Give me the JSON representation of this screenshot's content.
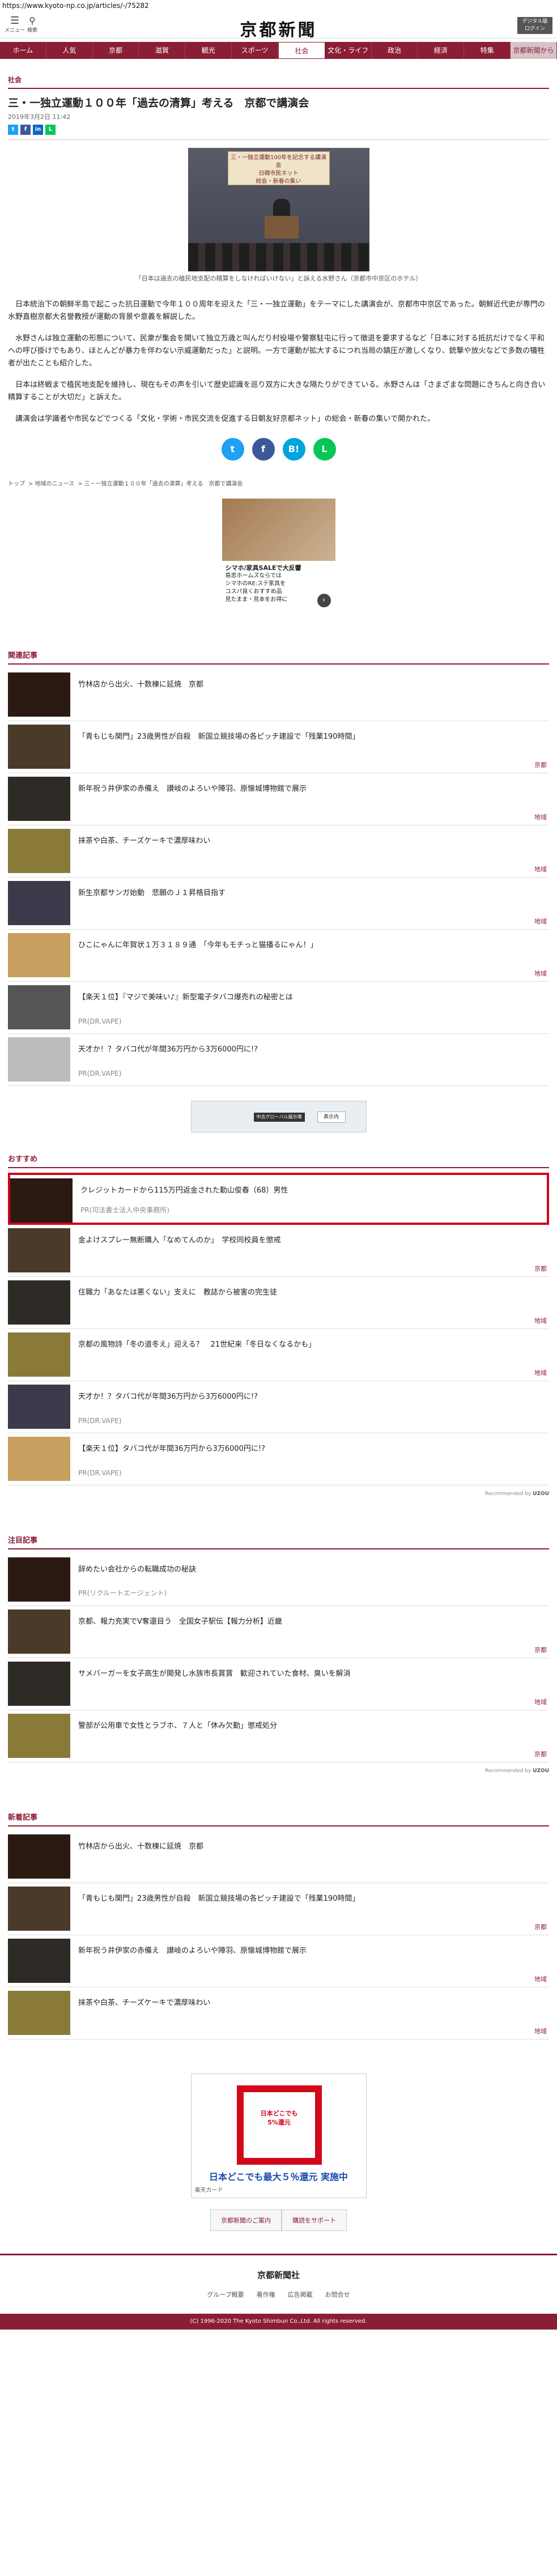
{
  "browser": {
    "url": "https://www.kyoto-np.co.jp/articles/-/75282"
  },
  "header": {
    "menu_label": "メニュー",
    "search_label": "検索",
    "logo_text": "京都新聞",
    "digital_label": "デジタル版\nログイン"
  },
  "nav": [
    "ホーム",
    "人気",
    "京都",
    "滋賀",
    "観光",
    "スポーツ",
    "社会",
    "文化・ライフ",
    "政治",
    "経済",
    "特集",
    "京都新聞から"
  ],
  "article": {
    "category": "社会",
    "title": "三・一独立運動１００年「過去の清算」考える　京都で講演会",
    "date": "2019年3月2日 11:42",
    "photo_banner": "三・一独立運動100年を記念する講演会\n日韓市民ネット\n総会・新春の集い",
    "caption": "「日本は過去の植民地支配の精算をしなければいけない」と訴える水野さん（京都市中京区のホテル）",
    "paragraphs": [
      "日本統治下の朝鮮半島で起こった抗日運動で今年１００周年を迎えた「三・一独立運動」をテーマにした講演会が、京都市中京区であった。朝鮮近代史が専門の水野直樹京都大名誉教授が運動の背景や意義を解説した。",
      "水野さんは独立運動の形態について、民衆が集会を開いて独立万歳と叫んだり村役場や警察駐屯に行って徴退を要求するなど「日本に対する抵抗だけでなく平和への呼び掛けでもあり、ほとんどが暴力を伴わない示威運動だった」と説明。一方で運動が拡大するにつれ当局の鎮圧が激しくなり、銃撃や放火などで多数の犠牲者が出たことも紹介した。",
      "日本は終戦まで植民地支配を維持し、現在もその声を引いて歴史認識を巡り双方に大きな隔たりができている。水野さんは「さまざまな問題にきちんと向き合い精算することが大切だ」と訴えた。",
      "講演会は学識者や市民などでつくる「文化・学術・市民交流を促進する日朝友好京都ネット」の総会・新春の集いで開かれた。"
    ],
    "share": [
      "twitter",
      "facebook",
      "hatena",
      "line"
    ],
    "breadcrumb": [
      "トップ",
      "地域のニュース",
      "三・一独立運動１００年「過去の清算」考える　京都で講演会"
    ]
  },
  "ads": {
    "ad1_title": "シマホ/家具SALEで大反響",
    "ad1_lines": [
      "島忠ホームズならでは",
      "シマホのRE:ステ家具を",
      "コスパ良くおすすめ品",
      "見たまま・見本をお得に"
    ],
    "map_ad_text": "中古グローバル展示場",
    "map_ad_button": "表示内",
    "ad2_card": "日本どこでも\n5%還元",
    "ad2_title": "日本どこでも最大５％還元 実施中",
    "ad2_source": "楽天カード"
  },
  "sections": {
    "related_title": "関連記事",
    "related": [
      {
        "title": "竹林店から出火、十数棟に延焼　京都",
        "tag": "",
        "pr": ""
      },
      {
        "title": "「青もじも関門」23歳男性が自殺　新国立競技場の各ピッチ建設で「残業190時間」",
        "tag": "京都",
        "pr": ""
      },
      {
        "title": "新年祝う井伊家の赤備え　讃岐のよろいや陣羽、原懐城博物館で展示",
        "tag": "地域",
        "pr": ""
      },
      {
        "title": "抹茶や白茶、チーズケーキで濃厚味わい",
        "tag": "地域",
        "pr": ""
      },
      {
        "title": "新生京都サンガ始動　悲願のＪ１昇格目指す",
        "tag": "地域",
        "pr": ""
      },
      {
        "title": "ひこにゃんに年賀状１万３１８９通　「今年もモチっと猫播るにゃん！」",
        "tag": "地域",
        "pr": ""
      },
      {
        "title": "【楽天１位】『マジで美味い♪』新型電子タバコ爆売れの秘密とは",
        "tag": "",
        "pr": "PR(DR.VAPE)"
      },
      {
        "title": "天才か！？タバコ代が年間36万円から3万6000円に!?",
        "tag": "",
        "pr": "PR(DR.VAPE)"
      }
    ],
    "recommend_title": "おすすめ",
    "recommend": [
      {
        "title": "クレジットカードから115万円返金された勤山俊春（68）男性",
        "tag": "",
        "pr": "PR(司法書士法人中央事務所)"
      },
      {
        "title": "金よけスプレー無断購入「なめてんのか」　学校同校員を懲戒",
        "tag": "京都",
        "pr": ""
      },
      {
        "title": "住職力「あなたは悪くない」支えに　教誌から被害の完生徒",
        "tag": "地域",
        "pr": ""
      },
      {
        "title": "京都の風物詩「冬の道冬え」迎える？　21世紀来「冬日なくなるかも」",
        "tag": "地域",
        "pr": ""
      },
      {
        "title": "天才か！？タバコ代が年間36万円から3万6000円に!?",
        "tag": "",
        "pr": "PR(DR.VAPE)"
      },
      {
        "title": "【楽天１位】タバコ代が年間36万円から3万6000円に!?",
        "tag": "",
        "pr": "PR(DR.VAPE)"
      }
    ],
    "recommend_credit": "Recommended by",
    "recommend_brand": "UZOU",
    "attention_title": "注目記事",
    "attention": [
      {
        "title": "辞めたい会社からの転職成功の秘訣",
        "tag": "",
        "pr": "PR(リクルートエージェント)"
      },
      {
        "title": "京都、報力充実でV奪還目う　全国女子駅伝【報力分析】近畿",
        "tag": "京都",
        "pr": ""
      },
      {
        "title": "サメバーガーを女子高生が開発し水族市長賞賞　歓迎されていた食材、臭いを解消",
        "tag": "地域",
        "pr": ""
      },
      {
        "title": "警部が公用車で女性とラブホ、７人と「休み欠勤」懲戒処分",
        "tag": "京都",
        "pr": ""
      }
    ],
    "new_title": "新着記事",
    "new": [
      {
        "title": "竹林店から出火、十数棟に延焼　京都",
        "tag": "",
        "pr": ""
      },
      {
        "title": "「青もじも関門」23歳男性が自殺　新国立競技場の各ピッチ建設で「残業190時間」",
        "tag": "京都",
        "pr": ""
      },
      {
        "title": "新年祝う井伊家の赤備え　讃岐のよろいや陣羽、原懐城博物館で展示",
        "tag": "地域",
        "pr": ""
      },
      {
        "title": "抹茶や白茶、チーズケーキで濃厚味わい",
        "tag": "地域",
        "pr": ""
      }
    ]
  },
  "footer": {
    "links": [
      "京都新聞のご案内",
      "購読をサポート"
    ],
    "logo": "京都新聞社",
    "nav": [
      "グループ概要",
      "著作権",
      "広告掲載",
      "お問合せ"
    ],
    "copyright": "(C) 1996-2020 The Kyoto Shimbun Co.,Ltd. All rights reserved."
  },
  "colors": {
    "brand": "#8a1e35",
    "highlight": "#d0021b"
  }
}
